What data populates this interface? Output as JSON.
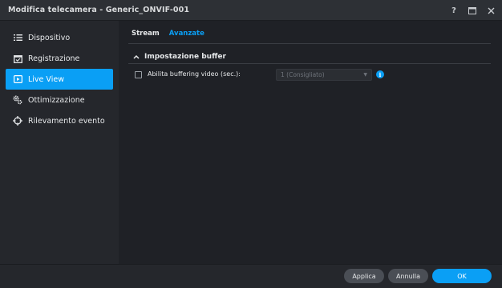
{
  "window": {
    "title": "Modifica telecamera - Generic_ONVIF-001",
    "controls": [
      "help-icon",
      "maximize-icon",
      "close-icon"
    ]
  },
  "sidebar": {
    "items": [
      {
        "label": "Dispositivo",
        "icon": "list-icon",
        "active": false
      },
      {
        "label": "Registrazione",
        "icon": "calendar-check-icon",
        "active": false
      },
      {
        "label": "Live View",
        "icon": "play-screen-icon",
        "active": true
      },
      {
        "label": "Ottimizzazione",
        "icon": "gears-icon",
        "active": false
      },
      {
        "label": "Rilevamento evento",
        "icon": "crosshair-icon",
        "active": false
      }
    ]
  },
  "main": {
    "tabs": [
      {
        "label": "Stream",
        "active": false
      },
      {
        "label": "Avanzate",
        "active": true
      }
    ],
    "section": {
      "title": "Impostazione buffer",
      "expanded": true
    },
    "buffering": {
      "label": "Abilita buffering video (sec.):",
      "checked": false,
      "select_value": "1 (Consigliato)",
      "info_icon": "info-icon"
    }
  },
  "footer": {
    "apply": "Applica",
    "cancel": "Annulla",
    "ok": "OK"
  },
  "colors": {
    "accent": "#0a9ff5",
    "sidebar_bg": "#25272c",
    "content_bg": "#1f2126"
  }
}
